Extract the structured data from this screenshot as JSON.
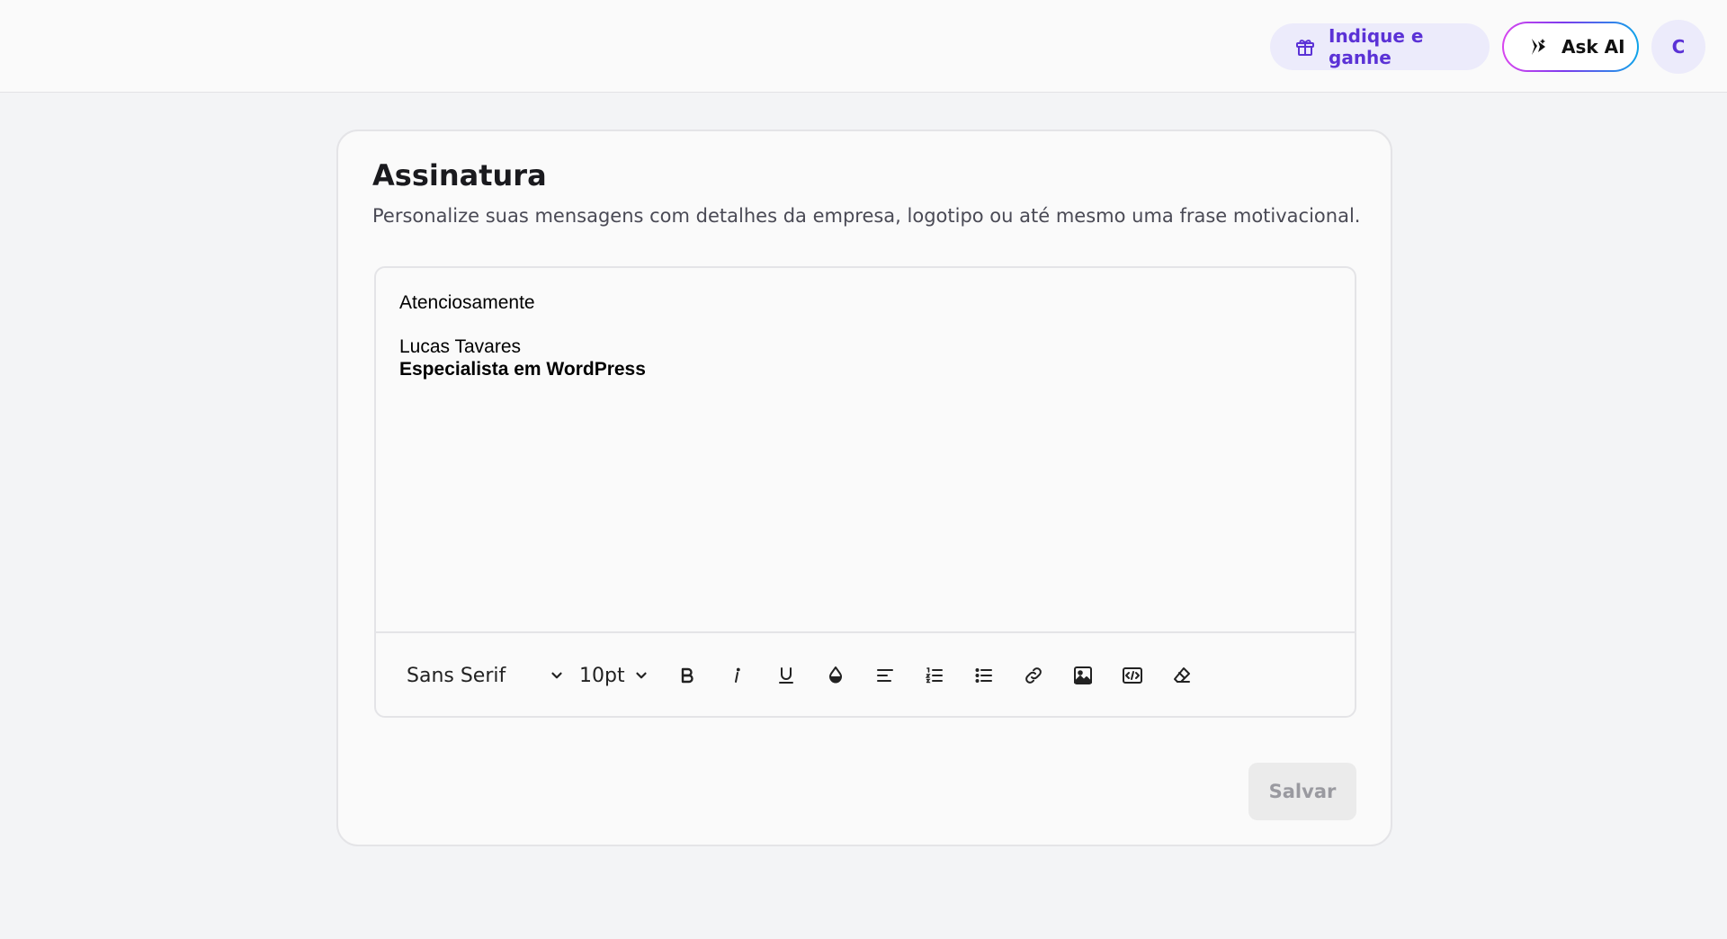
{
  "header": {
    "referral_label": "Indique e ganhe",
    "ask_ai_label": "Ask AI",
    "avatar_initial": "C"
  },
  "signature": {
    "title": "Assinatura",
    "description": "Personalize suas mensagens com detalhes da empresa, logotipo ou até mesmo uma frase motivacional.",
    "content": {
      "line1": "Atenciosamente",
      "line2": "Lucas Tavares",
      "line3": "Especialista em WordPress"
    },
    "toolbar": {
      "font_family": "Sans Serif",
      "font_size": "10pt",
      "buttons": [
        "bold",
        "italic",
        "underline",
        "text-color",
        "align",
        "ordered-list",
        "bullet-list",
        "link",
        "image",
        "code",
        "clear-format"
      ]
    },
    "save_label": "Salvar"
  },
  "colors": {
    "accent": "#5b32d6",
    "accent_bg": "#ecebfb",
    "page_bg": "#f3f4f6",
    "card_bg": "#fafafa",
    "disabled_text": "#9a9aa0"
  }
}
